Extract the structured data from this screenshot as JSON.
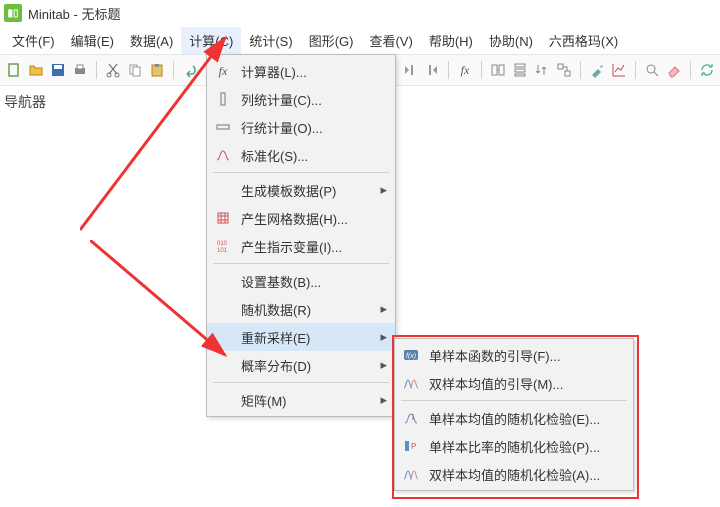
{
  "title": "Minitab - 无标题",
  "menubar": [
    "文件(F)",
    "编辑(E)",
    "数据(A)",
    "计算(C)",
    "统计(S)",
    "图形(G)",
    "查看(V)",
    "帮助(H)",
    "协助(N)",
    "六西格玛(X)"
  ],
  "nav_pane_label": "导航器",
  "calc_menu": {
    "calculator": "计算器(L)...",
    "col_stats": "列统计量(C)...",
    "row_stats": "行统计量(O)...",
    "standardize": "标准化(S)...",
    "make_patterned": "生成模板数据(P)",
    "make_mesh": "产生网格数据(H)...",
    "make_indicator": "产生指示变量(I)...",
    "set_base": "设置基数(B)...",
    "random_data": "随机数据(R)",
    "resample": "重新采样(E)",
    "prob_dist": "概率分布(D)",
    "matrices": "矩阵(M)"
  },
  "resample_submenu": {
    "boot_fn": "单样本函数的引导(F)...",
    "boot_2mean": "双样本均值的引导(M)...",
    "rand_1mean": "单样本均值的随机化检验(E)...",
    "rand_1prop": "单样本比率的随机化检验(P)...",
    "rand_2mean": "双样本均值的随机化检验(A)..."
  },
  "arrow_glyph": "▸"
}
